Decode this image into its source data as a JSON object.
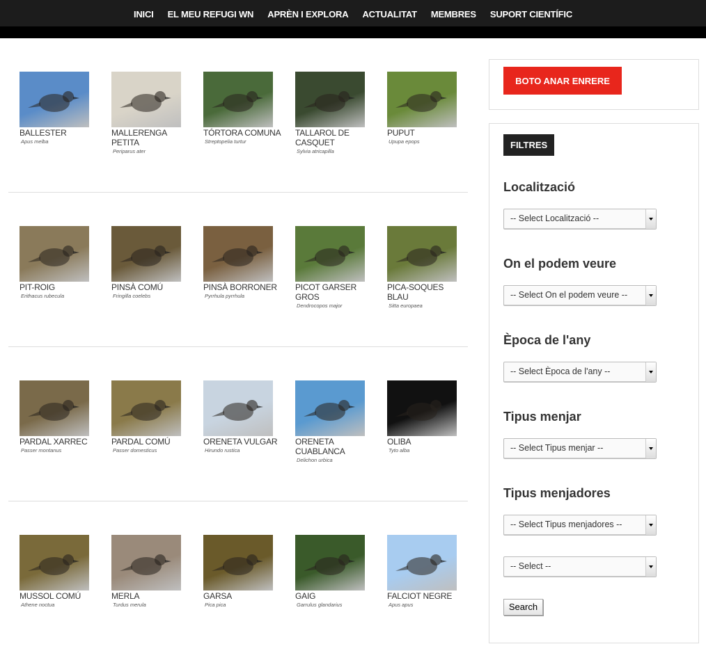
{
  "nav": [
    "INICI",
    "EL MEU REFUGI WN",
    "APRÈN I EXPLORA",
    "ACTUALITAT",
    "MEMBRES",
    "SUPORT CIENTÍFIC"
  ],
  "birds": [
    [
      {
        "name": "BALLESTER",
        "sci": "Apus melba",
        "icon": "alpine-swift-photo",
        "color": "#5a8cc8"
      },
      {
        "name": "MALLERENGA PETITA",
        "sci": "Periparus ater",
        "icon": "coal-tit-photo",
        "color": "#d9d4c8"
      },
      {
        "name": "TÓRTORA COMUNA",
        "sci": "Streptopelia turtur",
        "icon": "turtle-dove-photo",
        "color": "#4a6a3a"
      },
      {
        "name": "TALLAROL DE CASQUET",
        "sci": "Sylvia atricapilla",
        "icon": "blackcap-photo",
        "color": "#3a4a30"
      },
      {
        "name": "PUPUT",
        "sci": "Upupa epops",
        "icon": "hoopoe-photo",
        "color": "#6a8a3a"
      }
    ],
    [
      {
        "name": "PIT-ROIG",
        "sci": "Erithacus rubecula",
        "icon": "robin-photo",
        "color": "#8a7a5a"
      },
      {
        "name": "PINSÀ COMÚ",
        "sci": "Fringilla coelebs",
        "icon": "chaffinch-photo",
        "color": "#6a5a3a"
      },
      {
        "name": "PINSÀ BORRONER",
        "sci": "Pyrrhula pyrrhula",
        "icon": "bullfinch-photo",
        "color": "#7a6040"
      },
      {
        "name": "PICOT GARSER GROS",
        "sci": "Dendrocopos major",
        "icon": "woodpecker-photo",
        "color": "#5a7a3a"
      },
      {
        "name": "PICA-SOQUES BLAU",
        "sci": "Sitta europaea",
        "icon": "nuthatch-photo",
        "color": "#6a7a3a"
      }
    ],
    [
      {
        "name": "PARDAL XARREC",
        "sci": "Passer montanus",
        "icon": "tree-sparrow-photo",
        "color": "#7a6a4a"
      },
      {
        "name": "PARDAL COMÚ",
        "sci": "Passer domesticus",
        "icon": "house-sparrow-photo",
        "color": "#8a7a4a"
      },
      {
        "name": "ORENETA VULGAR",
        "sci": "Hirundo rustica",
        "icon": "barn-swallow-photo",
        "color": "#c8d4e0"
      },
      {
        "name": "ORENETA CUABLANCA",
        "sci": "Delichon urbica",
        "icon": "house-martin-photo",
        "color": "#5a9ad0"
      },
      {
        "name": "OLIBA",
        "sci": "Tyto alba",
        "icon": "barn-owl-photo",
        "color": "#111111"
      }
    ],
    [
      {
        "name": "MUSSOL COMÚ",
        "sci": "Athene noctua",
        "icon": "little-owl-photo",
        "color": "#7a6a3a"
      },
      {
        "name": "MERLA",
        "sci": "Turdus merula",
        "icon": "blackbird-photo",
        "color": "#9a8a7a"
      },
      {
        "name": "GARSA",
        "sci": "Pica pica",
        "icon": "magpie-photo",
        "color": "#6a5a2a"
      },
      {
        "name": "GAIG",
        "sci": "Garrulus glandarius",
        "icon": "jay-photo",
        "color": "#3a5a2a"
      },
      {
        "name": "FALCIOT NEGRE",
        "sci": "Apus apus",
        "icon": "common-swift-photo",
        "color": "#a8ccf0"
      }
    ]
  ],
  "sidebar": {
    "back_label": "BOTO ANAR ENRERE",
    "filters_title": "FILTRES",
    "filters": [
      {
        "label": "Localització",
        "select": "-- Select Localització --"
      },
      {
        "label": "On el podem veure",
        "select": "-- Select On el podem veure --"
      },
      {
        "label": "Època de l'any",
        "select": "-- Select Època de l'any --"
      },
      {
        "label": "Tipus menjar",
        "select": "-- Select Tipus menjar --"
      },
      {
        "label": "Tipus menjadores",
        "select": "-- Select Tipus menjadores --"
      }
    ],
    "extra_select": "-- Select --",
    "search_label": "Search"
  }
}
